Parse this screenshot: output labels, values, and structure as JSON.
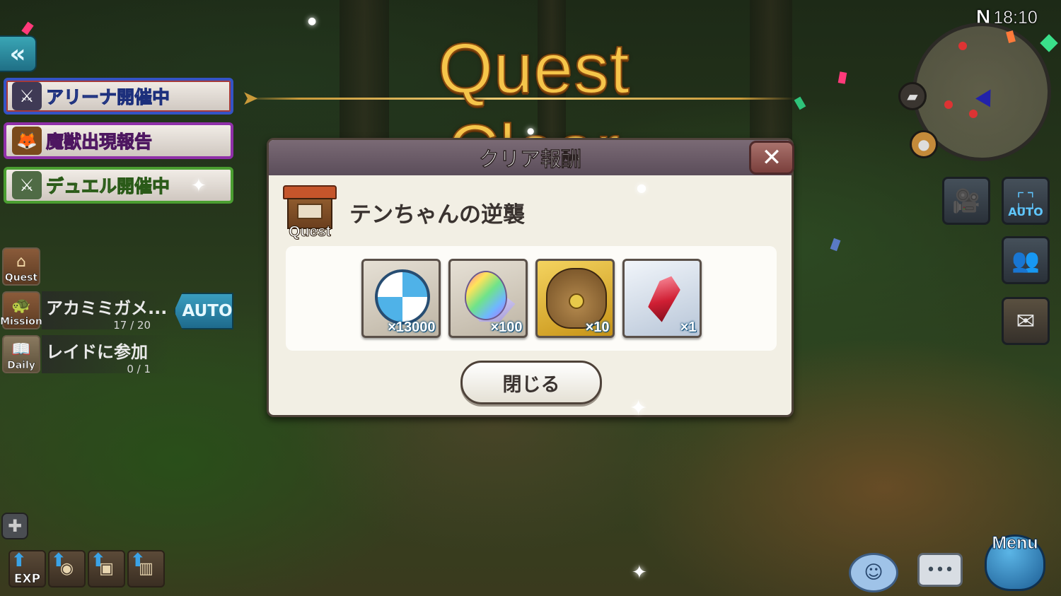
{
  "header": {
    "title": "Quest Clear"
  },
  "left_panel": {
    "events": [
      {
        "label": "アリーナ開催中",
        "icon": "arena-icon"
      },
      {
        "label": "魔獣出現報告",
        "icon": "beast-icon"
      },
      {
        "label": "デュエル開催中",
        "icon": "duel-icon"
      }
    ],
    "trackers": [
      {
        "tag": "Quest",
        "title": "",
        "progress": ""
      },
      {
        "tag": "Mission",
        "title": "アカミミガメ...",
        "progress": "17 / 20"
      },
      {
        "tag": "Daily",
        "title": "レイドに参加",
        "progress": "0 / 1"
      }
    ],
    "auto_label": "AUTO"
  },
  "dialog": {
    "title": "クリア報酬",
    "quest_tag": "Quest",
    "quest_name": "テンちゃんの逆襲",
    "rewards": [
      {
        "icon": "beach-ball-icon",
        "qty": "×13000",
        "frame": "silver"
      },
      {
        "icon": "rainbow-egg-icon",
        "qty": "×100",
        "frame": "silver"
      },
      {
        "icon": "treasure-bag-icon",
        "qty": "×10",
        "frame": "gold"
      },
      {
        "icon": "red-crystal-icon",
        "qty": "×1",
        "frame": "blue"
      }
    ],
    "close_label": "閉じる"
  },
  "hud": {
    "compass": "N",
    "time": "18:10",
    "auto_label": "AUTO",
    "menu_label": "Menu"
  },
  "bottom_bar": {
    "exp_label": "EXP"
  },
  "colors": {
    "title_gold": "#f5c54a",
    "dialog_bg": "#f2efe4",
    "dialog_header": "#6a5a67",
    "accent_blue": "#3a9ec0"
  }
}
